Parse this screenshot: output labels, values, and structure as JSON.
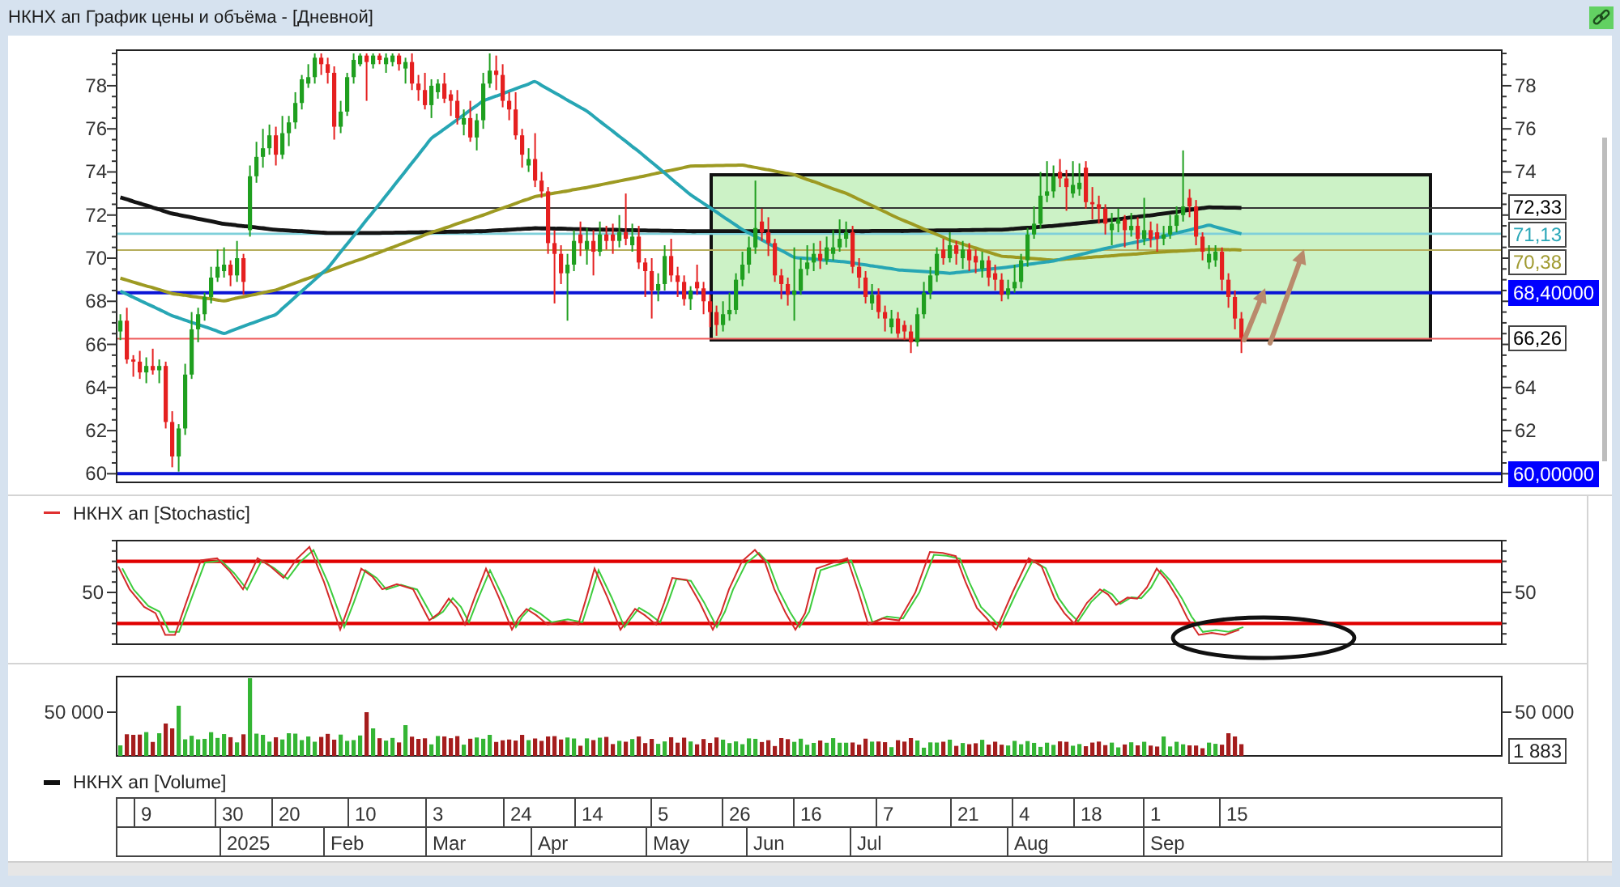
{
  "window": {
    "title": "НКНХ ап График цены и объёма - [Дневной]"
  },
  "price_panel": {
    "candle_chart": {
      "chart_data": {
        "type": "candlestick",
        "categories": [
          null,
          null,
          null,
          null,
          null,
          null,
          null,
          null,
          null,
          null,
          null,
          null,
          null,
          null,
          null,
          null,
          null,
          null,
          null,
          null,
          null,
          null,
          null,
          null,
          null,
          null,
          null,
          null,
          null,
          null,
          null,
          null,
          null,
          null,
          null,
          null,
          null,
          null,
          null,
          null,
          null,
          null,
          null,
          null,
          null,
          null,
          null,
          null,
          null,
          null,
          null,
          null,
          null,
          null,
          null,
          null,
          null,
          null,
          null,
          null,
          null,
          null,
          null,
          null,
          null,
          null,
          null,
          null,
          null,
          null,
          null,
          null,
          null,
          null,
          null,
          null,
          null,
          null,
          null,
          null,
          null,
          null,
          null,
          null,
          null,
          null,
          null,
          null,
          null,
          null,
          null,
          null,
          null,
          null,
          null,
          null,
          null,
          null,
          null,
          null,
          null,
          null,
          null,
          null,
          null,
          null,
          null,
          null,
          null,
          null,
          null,
          null,
          null,
          null,
          null,
          null,
          null,
          null,
          null,
          null,
          null,
          null,
          null,
          null,
          null,
          null,
          null,
          null,
          null,
          null,
          null,
          null,
          null,
          null,
          null,
          null,
          null,
          null,
          null,
          null,
          null,
          null,
          null,
          null,
          null,
          null,
          null,
          null,
          null,
          null,
          null,
          null,
          null,
          null,
          null,
          null,
          null,
          null,
          null,
          null,
          null,
          null,
          null,
          null,
          null,
          null,
          null,
          null,
          null,
          null,
          null,
          null,
          null,
          null
        ],
        "ohlc": [
          [
            66.6,
            67.4,
            66.2,
            67.1
          ],
          [
            67.1,
            67.7,
            65.1,
            65.3
          ],
          [
            65.3,
            65.5,
            64.5,
            65.2
          ],
          [
            65.2,
            65.7,
            64.4,
            64.7
          ],
          [
            64.7,
            65.4,
            64.2,
            65.0
          ],
          [
            65.0,
            65.8,
            64.6,
            64.8
          ],
          [
            64.8,
            65.3,
            64.2,
            65.0
          ],
          [
            65.0,
            65.2,
            62.1,
            62.4
          ],
          [
            62.4,
            62.9,
            60.3,
            60.8
          ],
          [
            60.8,
            62.3,
            60.1,
            62.1
          ],
          [
            62.1,
            65.1,
            61.8,
            64.6
          ],
          [
            64.6,
            67.5,
            64.4,
            66.7
          ],
          [
            66.7,
            67.7,
            66.1,
            67.4
          ],
          [
            67.4,
            68.4,
            67.1,
            68.2
          ],
          [
            68.2,
            69.6,
            67.9,
            69.1
          ],
          [
            69.1,
            70.4,
            68.9,
            69.6
          ],
          [
            69.4,
            70.5,
            69.1,
            69.7
          ],
          [
            69.7,
            69.9,
            68.7,
            69.2
          ],
          [
            69.2,
            70.8,
            68.9,
            70.0
          ],
          [
            70.0,
            70.2,
            68.3,
            68.9
          ],
          [
            71.3,
            74.3,
            71.0,
            73.8
          ],
          [
            73.8,
            75.4,
            73.5,
            74.7
          ],
          [
            74.7,
            76.0,
            74.2,
            75.1
          ],
          [
            75.1,
            76.2,
            74.8,
            75.7
          ],
          [
            75.7,
            76.1,
            74.3,
            74.8
          ],
          [
            74.8,
            76.6,
            74.6,
            75.8
          ],
          [
            75.8,
            76.6,
            75.2,
            76.3
          ],
          [
            76.3,
            77.7,
            76.0,
            77.2
          ],
          [
            77.2,
            78.5,
            76.9,
            78.3
          ],
          [
            78.1,
            79.0,
            77.9,
            78.4
          ],
          [
            78.4,
            79.5,
            78.1,
            79.3
          ],
          [
            79.3,
            79.5,
            78.5,
            79.0
          ],
          [
            79.0,
            79.3,
            78.1,
            78.6
          ],
          [
            78.6,
            78.9,
            75.5,
            76.1
          ],
          [
            76.1,
            77.3,
            75.8,
            76.8
          ],
          [
            76.8,
            78.6,
            76.6,
            78.4
          ],
          [
            78.4,
            79.5,
            78.1,
            79.2
          ],
          [
            79.0,
            79.5,
            78.9,
            79.4
          ],
          [
            79.4,
            79.5,
            77.3,
            79.1
          ],
          [
            79.0,
            79.5,
            78.8,
            79.4
          ],
          [
            79.4,
            79.5,
            79.0,
            79.2
          ],
          [
            79.0,
            79.5,
            78.6,
            79.3
          ],
          [
            79.1,
            79.5,
            78.9,
            79.4
          ],
          [
            79.4,
            79.5,
            78.7,
            79.0
          ],
          [
            78.8,
            79.3,
            78.1,
            79.1
          ],
          [
            79.1,
            79.5,
            77.8,
            78.1
          ],
          [
            78.1,
            78.5,
            77.3,
            77.8
          ],
          [
            77.8,
            78.6,
            76.9,
            77.1
          ],
          [
            77.1,
            78.3,
            76.5,
            78.0
          ],
          [
            77.7,
            78.3,
            77.4,
            78.1
          ],
          [
            78.1,
            78.6,
            77.2,
            77.4
          ],
          [
            77.6,
            77.8,
            76.6,
            77.3
          ],
          [
            77.3,
            77.8,
            76.2,
            76.5
          ],
          [
            76.2,
            76.9,
            75.7,
            76.5
          ],
          [
            76.5,
            77.3,
            75.4,
            75.6
          ],
          [
            75.6,
            76.7,
            75.0,
            76.4
          ],
          [
            76.4,
            78.6,
            76.0,
            78.1
          ],
          [
            78.1,
            79.5,
            77.9,
            78.7
          ],
          [
            78.7,
            79.4,
            77.8,
            78.5
          ],
          [
            78.5,
            79.0,
            77.0,
            77.3
          ],
          [
            77.3,
            77.7,
            76.4,
            76.9
          ],
          [
            76.9,
            77.7,
            75.5,
            75.7
          ],
          [
            75.7,
            76.0,
            74.2,
            74.8
          ],
          [
            74.3,
            75.1,
            74.0,
            74.6
          ],
          [
            74.6,
            75.8,
            73.3,
            73.6
          ],
          [
            73.6,
            74.0,
            72.8,
            73.1
          ],
          [
            73.1,
            73.3,
            70.2,
            70.7
          ],
          [
            70.7,
            71.3,
            67.9,
            70.2
          ],
          [
            70.2,
            70.6,
            68.8,
            69.3
          ],
          [
            69.3,
            70.2,
            67.1,
            69.7
          ],
          [
            69.7,
            71.3,
            69.4,
            70.8
          ],
          [
            71.1,
            71.7,
            70.1,
            70.7
          ],
          [
            70.4,
            71.4,
            69.7,
            70.8
          ],
          [
            70.8,
            71.3,
            69.2,
            70.3
          ],
          [
            70.3,
            71.7,
            70.1,
            71.1
          ],
          [
            71.1,
            71.5,
            70.4,
            70.8
          ],
          [
            71.1,
            71.6,
            70.2,
            70.8
          ],
          [
            70.8,
            72.0,
            70.5,
            71.2
          ],
          [
            71.2,
            73.0,
            70.6,
            70.9
          ],
          [
            70.6,
            71.6,
            70.3,
            71.0
          ],
          [
            71.0,
            71.5,
            69.5,
            69.8
          ],
          [
            69.8,
            70.0,
            68.2,
            69.4
          ],
          [
            69.4,
            70.0,
            67.2,
            68.5
          ],
          [
            68.5,
            69.3,
            68.0,
            68.8
          ],
          [
            68.8,
            70.6,
            68.5,
            70.1
          ],
          [
            70.1,
            70.9,
            68.9,
            69.2
          ],
          [
            69.2,
            69.6,
            68.2,
            68.9
          ],
          [
            68.9,
            69.2,
            67.8,
            68.1
          ],
          [
            68.1,
            68.7,
            67.6,
            68.5
          ],
          [
            68.9,
            69.7,
            68.3,
            68.6
          ],
          [
            68.6,
            68.9,
            67.4,
            68.0
          ],
          [
            68.0,
            68.3,
            66.8,
            67.5
          ],
          [
            67.5,
            67.8,
            66.4,
            66.9
          ],
          [
            66.9,
            68.0,
            66.6,
            67.4
          ],
          [
            67.4,
            68.4,
            67.1,
            67.6
          ],
          [
            67.6,
            69.3,
            67.4,
            69.0
          ],
          [
            69.0,
            70.3,
            68.7,
            69.7
          ],
          [
            69.7,
            71.0,
            69.3,
            70.5
          ],
          [
            70.5,
            73.6,
            70.2,
            71.4
          ],
          [
            71.7,
            72.3,
            70.8,
            71.2
          ],
          [
            71.2,
            71.9,
            70.1,
            70.7
          ],
          [
            70.7,
            70.9,
            68.9,
            69.2
          ],
          [
            69.2,
            69.5,
            68.1,
            68.8
          ],
          [
            68.8,
            69.1,
            67.8,
            68.3
          ],
          [
            68.3,
            70.5,
            67.1,
            68.5
          ],
          [
            68.5,
            70.0,
            68.3,
            69.5
          ],
          [
            69.5,
            70.6,
            69.2,
            69.8
          ],
          [
            69.8,
            70.7,
            69.4,
            70.2
          ],
          [
            70.2,
            70.8,
            69.5,
            69.9
          ],
          [
            69.9,
            71.0,
            69.7,
            70.5
          ],
          [
            70.2,
            71.3,
            69.9,
            70.5
          ],
          [
            70.5,
            71.8,
            70.3,
            70.9
          ],
          [
            70.9,
            71.7,
            70.5,
            71.2
          ],
          [
            71.2,
            71.5,
            69.3,
            69.6
          ],
          [
            69.6,
            70.0,
            68.6,
            69.1
          ],
          [
            69.1,
            69.4,
            67.9,
            68.2
          ],
          [
            67.9,
            68.8,
            67.6,
            68.3
          ],
          [
            68.3,
            68.6,
            67.2,
            67.5
          ],
          [
            67.5,
            67.8,
            66.6,
            67.2
          ],
          [
            66.8,
            67.6,
            66.5,
            67.2
          ],
          [
            67.2,
            67.5,
            66.3,
            66.5
          ],
          [
            66.9,
            67.1,
            66.2,
            66.6
          ],
          [
            66.6,
            66.9,
            65.6,
            66.1
          ],
          [
            66.1,
            67.7,
            65.9,
            67.4
          ],
          [
            67.4,
            68.9,
            67.2,
            68.4
          ],
          [
            68.4,
            69.6,
            68.1,
            69.2
          ],
          [
            69.2,
            70.5,
            68.9,
            70.2
          ],
          [
            70.4,
            70.9,
            69.7,
            70.0
          ],
          [
            70.0,
            71.2,
            69.8,
            70.6
          ],
          [
            70.6,
            70.8,
            69.7,
            70.2
          ],
          [
            70.0,
            70.8,
            69.5,
            70.4
          ],
          [
            70.4,
            70.7,
            69.4,
            69.9
          ],
          [
            70.1,
            70.4,
            69.3,
            69.8
          ],
          [
            69.5,
            70.3,
            69.1,
            69.9
          ],
          [
            69.9,
            70.1,
            68.7,
            69.1
          ],
          [
            69.3,
            69.7,
            68.5,
            69.0
          ],
          [
            69.0,
            69.3,
            68.0,
            68.3
          ],
          [
            68.3,
            69.0,
            68.1,
            68.6
          ],
          [
            68.6,
            69.7,
            68.4,
            68.9
          ],
          [
            68.9,
            70.2,
            68.6,
            69.9
          ],
          [
            69.9,
            71.4,
            69.6,
            71.1
          ],
          [
            71.1,
            72.4,
            70.9,
            71.6
          ],
          [
            71.6,
            74.0,
            71.4,
            72.9
          ],
          [
            72.9,
            74.5,
            72.6,
            73.1
          ],
          [
            73.1,
            74.3,
            72.8,
            73.8
          ],
          [
            74.0,
            74.6,
            73.3,
            73.7
          ],
          [
            73.7,
            74.1,
            72.2,
            73.3
          ],
          [
            73.0,
            74.5,
            72.8,
            73.4
          ],
          [
            73.2,
            74.4,
            72.9,
            73.5
          ],
          [
            74.2,
            74.5,
            72.3,
            72.6
          ],
          [
            72.6,
            73.3,
            71.8,
            72.5
          ],
          [
            72.5,
            72.9,
            71.6,
            72.3
          ],
          [
            72.3,
            72.5,
            71.1,
            71.6
          ],
          [
            71.3,
            72.1,
            70.6,
            71.6
          ],
          [
            71.6,
            72.3,
            71.2,
            71.8
          ],
          [
            71.8,
            72.0,
            70.5,
            71.3
          ],
          [
            71.3,
            72.1,
            71.0,
            71.5
          ],
          [
            71.5,
            71.9,
            70.4,
            70.9
          ],
          [
            70.9,
            72.8,
            70.6,
            71.3
          ],
          [
            71.3,
            71.7,
            70.5,
            70.9
          ],
          [
            71.2,
            71.6,
            70.3,
            70.9
          ],
          [
            70.9,
            71.5,
            70.6,
            71.1
          ],
          [
            71.1,
            72.0,
            70.9,
            71.5
          ],
          [
            71.5,
            72.4,
            71.2,
            72.0
          ],
          [
            72.0,
            75.0,
            71.7,
            72.4
          ],
          [
            72.8,
            73.2,
            71.9,
            72.4
          ],
          [
            72.4,
            72.7,
            70.6,
            71.0
          ],
          [
            71.0,
            71.2,
            69.9,
            70.3
          ],
          [
            69.8,
            70.6,
            69.5,
            70.2
          ],
          [
            69.9,
            70.6,
            69.6,
            70.3
          ],
          [
            70.3,
            70.5,
            68.5,
            69.0
          ],
          [
            69.0,
            69.3,
            67.7,
            68.2
          ],
          [
            68.2,
            68.5,
            66.7,
            67.2
          ],
          [
            67.2,
            67.5,
            65.6,
            66.3
          ]
        ],
        "ylim": [
          59.6,
          79.65
        ],
        "yticks": [
          {
            "value": 78,
            "label": "78"
          },
          {
            "value": 76,
            "label": "76"
          },
          {
            "value": 74,
            "label": "74"
          },
          {
            "value": 72,
            "label": "72"
          },
          {
            "value": 70,
            "label": "70"
          },
          {
            "value": 68,
            "label": "68"
          },
          {
            "value": 66,
            "label": "66"
          },
          {
            "value": 64,
            "label": "64"
          },
          {
            "value": 62,
            "label": "62"
          },
          {
            "value": 60,
            "label": "60"
          }
        ]
      }
    },
    "line_overlay": {
      "chart_data": {
        "type": "line",
        "categories": [
          null,
          null,
          null,
          null,
          null,
          null,
          null,
          null,
          null,
          null,
          null,
          null,
          null,
          null,
          null,
          null,
          null,
          null,
          null,
          null,
          null,
          null,
          null,
          null,
          null,
          null,
          null,
          null,
          null,
          null,
          null,
          null,
          null,
          null,
          null,
          null,
          null,
          null,
          null,
          null,
          null,
          null,
          null,
          null,
          null,
          null,
          null,
          null,
          null,
          null,
          null,
          null,
          null,
          null,
          null,
          null,
          null,
          null,
          null,
          null,
          null,
          null,
          null,
          null,
          null,
          null,
          null,
          null,
          null,
          null,
          null,
          null,
          null,
          null,
          null,
          null,
          null,
          null,
          null,
          null,
          null,
          null,
          null,
          null,
          null,
          null,
          null,
          null,
          null,
          null,
          null,
          null,
          null,
          null,
          null,
          null,
          null,
          null,
          null,
          null,
          null,
          null,
          null,
          null,
          null,
          null,
          null,
          null,
          null,
          null,
          null,
          null,
          null,
          null,
          null,
          null,
          null,
          null,
          null,
          null,
          null,
          null,
          null,
          null,
          null,
          null,
          null,
          null,
          null,
          null,
          null,
          null,
          null,
          null,
          null,
          null,
          null,
          null,
          null,
          null,
          null,
          null,
          null,
          null,
          null,
          null,
          null,
          null,
          null,
          null,
          null,
          null,
          null,
          null,
          null,
          null,
          null,
          null,
          null,
          null,
          null,
          null,
          null,
          null,
          null,
          null,
          null,
          null,
          null,
          null,
          null,
          null,
          null,
          null
        ],
        "series": [
          {
            "color": "#141414",
            "values": [
              72.82,
              72.73,
              72.63,
              72.54,
              72.45,
              72.35,
              72.26,
              72.16,
              72.07,
              72.01,
              71.95,
              71.89,
              71.83,
              71.77,
              71.71,
              71.65,
              71.59,
              71.56,
              71.52,
              71.49,
              71.46,
              71.42,
              71.39,
              71.35,
              71.32,
              71.3,
              71.28,
              71.26,
              71.25,
              71.23,
              71.21,
              71.19,
              71.17,
              71.17,
              71.17,
              71.17,
              71.17,
              71.17,
              71.17,
              71.17,
              71.17,
              71.18,
              71.18,
              71.19,
              71.19,
              71.2,
              71.2,
              71.21,
              71.21,
              71.22,
              71.22,
              71.23,
              71.23,
              71.24,
              71.24,
              71.25,
              71.25,
              71.27,
              71.29,
              71.3,
              71.32,
              71.34,
              71.36,
              71.37,
              71.39,
              71.38,
              71.38,
              71.37,
              71.37,
              71.36,
              71.35,
              71.35,
              71.34,
              71.33,
              71.33,
              71.32,
              71.32,
              71.31,
              71.3,
              71.3,
              71.29,
              71.29,
              71.28,
              71.28,
              71.27,
              71.27,
              71.26,
              71.26,
              71.25,
              71.25,
              71.25,
              71.25,
              71.25,
              71.25,
              71.25,
              71.25,
              71.25,
              71.25,
              71.25,
              71.25,
              71.25,
              71.25,
              71.25,
              71.25,
              71.25,
              71.25,
              71.25,
              71.25,
              71.25,
              71.25,
              71.25,
              71.25,
              71.25,
              71.25,
              71.25,
              71.25,
              71.26,
              71.26,
              71.26,
              71.26,
              71.26,
              71.26,
              71.27,
              71.27,
              71.28,
              71.28,
              71.29,
              71.29,
              71.29,
              71.29,
              71.3,
              71.3,
              71.31,
              71.31,
              71.32,
              71.32,
              71.32,
              71.34,
              71.37,
              71.39,
              71.41,
              71.43,
              71.46,
              71.48,
              71.5,
              71.53,
              71.56,
              71.59,
              71.62,
              71.65,
              71.68,
              71.71,
              71.74,
              71.78,
              71.81,
              71.85,
              71.89,
              71.92,
              71.96,
              71.99,
              72.03,
              72.07,
              72.11,
              72.15,
              72.2,
              72.24,
              72.28,
              72.32,
              72.36,
              72.35,
              72.35,
              72.34,
              72.34,
              72.33
            ]
          },
          {
            "color": "#9d9a22",
            "values": [
              69.07,
              68.98,
              68.89,
              68.8,
              68.71,
              68.63,
              68.54,
              68.45,
              68.36,
              68.32,
              68.28,
              68.23,
              68.19,
              68.15,
              68.11,
              68.06,
              68.02,
              68.08,
              68.15,
              68.21,
              68.27,
              68.33,
              68.4,
              68.46,
              68.52,
              68.63,
              68.74,
              68.85,
              68.96,
              69.07,
              69.18,
              69.29,
              69.4,
              69.51,
              69.62,
              69.73,
              69.84,
              69.94,
              70.05,
              70.16,
              70.27,
              70.39,
              70.5,
              70.62,
              70.73,
              70.85,
              70.96,
              71.08,
              71.19,
              71.29,
              71.39,
              71.49,
              71.6,
              71.7,
              71.8,
              71.9,
              72.0,
              72.11,
              72.22,
              72.32,
              72.43,
              72.54,
              72.65,
              72.75,
              72.86,
              72.91,
              72.97,
              73.02,
              73.07,
              73.12,
              73.18,
              73.23,
              73.28,
              73.34,
              73.4,
              73.46,
              73.52,
              73.58,
              73.64,
              73.7,
              73.76,
              73.82,
              73.89,
              73.95,
              74.02,
              74.08,
              74.14,
              74.21,
              74.27,
              74.28,
              74.28,
              74.29,
              74.3,
              74.3,
              74.31,
              74.31,
              74.32,
              74.26,
              74.21,
              74.15,
              74.1,
              74.04,
              73.98,
              73.93,
              73.87,
              73.76,
              73.65,
              73.55,
              73.44,
              73.33,
              73.22,
              73.11,
              73.01,
              72.87,
              72.72,
              72.58,
              72.44,
              72.29,
              72.15,
              72.0,
              71.86,
              71.73,
              71.61,
              71.48,
              71.35,
              71.22,
              71.1,
              70.97,
              70.84,
              70.75,
              70.65,
              70.56,
              70.47,
              70.37,
              70.28,
              70.18,
              70.09,
              70.07,
              70.05,
              70.02,
              70.0,
              69.98,
              69.96,
              69.93,
              69.91,
              69.93,
              69.96,
              69.98,
              70.0,
              70.02,
              70.05,
              70.07,
              70.09,
              70.11,
              70.14,
              70.16,
              70.18,
              70.2,
              70.23,
              70.25,
              70.27,
              70.29,
              70.31,
              70.32,
              70.34,
              70.36,
              70.38,
              70.39,
              70.41,
              70.4,
              70.4,
              70.39,
              70.39,
              70.38
            ]
          },
          {
            "color": "#27a6b4",
            "values": [
              68.47,
              68.33,
              68.19,
              68.04,
              67.9,
              67.76,
              67.62,
              67.47,
              67.33,
              67.23,
              67.12,
              67.02,
              66.92,
              66.82,
              66.72,
              66.61,
              66.51,
              66.62,
              66.73,
              66.84,
              66.95,
              67.06,
              67.17,
              67.28,
              67.39,
              67.66,
              67.93,
              68.2,
              68.47,
              68.73,
              69.0,
              69.27,
              69.54,
              69.91,
              70.29,
              70.66,
              71.03,
              71.4,
              71.78,
              72.15,
              72.52,
              72.9,
              73.28,
              73.66,
              74.04,
              74.42,
              74.8,
              75.18,
              75.56,
              75.78,
              75.99,
              76.21,
              76.43,
              76.65,
              76.87,
              77.08,
              77.3,
              77.41,
              77.52,
              77.63,
              77.75,
              77.86,
              77.97,
              78.08,
              78.19,
              78.02,
              77.85,
              77.68,
              77.51,
              77.33,
              77.16,
              76.99,
              76.82,
              76.59,
              76.35,
              76.12,
              75.89,
              75.65,
              75.42,
              75.18,
              74.95,
              74.7,
              74.45,
              74.2,
              73.95,
              73.69,
              73.44,
              73.19,
              72.94,
              72.74,
              72.54,
              72.34,
              72.14,
              71.93,
              71.73,
              71.53,
              71.33,
              71.17,
              71.01,
              70.85,
              70.69,
              70.52,
              70.36,
              70.2,
              70.04,
              70.01,
              69.99,
              69.96,
              69.93,
              69.9,
              69.88,
              69.85,
              69.82,
              69.78,
              69.73,
              69.69,
              69.64,
              69.6,
              69.55,
              69.51,
              69.46,
              69.44,
              69.42,
              69.4,
              69.38,
              69.36,
              69.34,
              69.32,
              69.3,
              69.33,
              69.36,
              69.39,
              69.43,
              69.46,
              69.49,
              69.52,
              69.55,
              69.59,
              69.63,
              69.67,
              69.71,
              69.75,
              69.79,
              69.83,
              69.87,
              69.94,
              70.02,
              70.09,
              70.16,
              70.23,
              70.31,
              70.38,
              70.45,
              70.51,
              70.58,
              70.64,
              70.7,
              70.76,
              70.83,
              70.89,
              70.95,
              71.02,
              71.1,
              71.17,
              71.24,
              71.31,
              71.39,
              71.46,
              71.53,
              71.45,
              71.37,
              71.29,
              71.21,
              71.13
            ]
          }
        ],
        "ref_lines": [
          {
            "axis": "y",
            "value": 72.33,
            "color": "#333333"
          },
          {
            "axis": "y",
            "value": 71.13,
            "color": "#7fd0da"
          },
          {
            "axis": "y",
            "value": 70.38,
            "color": "#b5ad5a"
          },
          {
            "axis": "y",
            "value": 68.4,
            "color": "#0a14d6"
          },
          {
            "axis": "y",
            "value": 66.26,
            "color": "#ee5a5a"
          },
          {
            "axis": "y",
            "value": 60,
            "color": "#0a14d6"
          }
        ],
        "ylim": [
          59.6,
          79.65
        ],
        "yticks": [
          {
            "value": 78,
            "label": "78"
          },
          {
            "value": 76,
            "label": "76"
          },
          {
            "value": 74,
            "label": "74"
          },
          {
            "value": 64,
            "label": "64"
          },
          {
            "value": 62,
            "label": "62"
          }
        ]
      }
    },
    "level_labels": [
      {
        "text": "72,33",
        "kind": "outlined",
        "color": "#000000"
      },
      {
        "text": "71,13",
        "kind": "outlined",
        "color": "#2aa7b8"
      },
      {
        "text": "70,38",
        "kind": "outlined",
        "color": "#a09a30"
      },
      {
        "text": "68,40000",
        "kind": "filled",
        "color": "#0000ff"
      },
      {
        "text": "66,26",
        "kind": "outlined",
        "color": "#000000"
      },
      {
        "text": "60,00000",
        "kind": "filled",
        "color": "#0000ff"
      }
    ]
  },
  "stochastic_panel": {
    "legend": "НКНХ ап [Stochastic]",
    "left_tick": "50",
    "right_tick": "50"
  },
  "volume_panel": {
    "left_tick": "50 000",
    "right_tick": "50 000",
    "last_value": "1 883",
    "legend": "НКНХ ап [Volume]"
  },
  "date_axis": {
    "days": [
      "9",
      "30",
      "20",
      "10",
      "3",
      "24",
      "14",
      "5",
      "26",
      "16",
      "7",
      "21",
      "4",
      "18",
      "1",
      "15"
    ],
    "months": [
      "2025",
      "Feb",
      "Mar",
      "Apr",
      "May",
      "Jun",
      "Jul",
      "Aug",
      "Sep"
    ]
  }
}
